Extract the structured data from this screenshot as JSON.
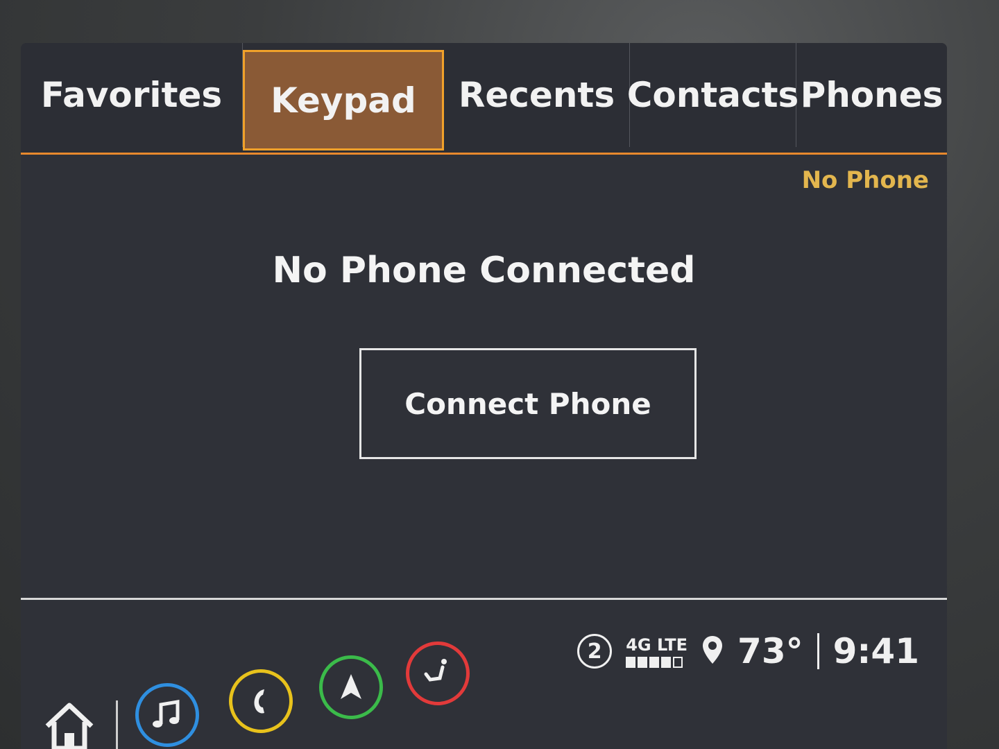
{
  "tabs": [
    {
      "label": "Favorites"
    },
    {
      "label": "Keypad"
    },
    {
      "label": "Recents"
    },
    {
      "label": "Contacts"
    },
    {
      "label": "Phones"
    }
  ],
  "active_tab": "Keypad",
  "status": {
    "phone_state": "No Phone"
  },
  "main": {
    "message": "No Phone Connected",
    "connect_label": "Connect Phone"
  },
  "status_bar": {
    "notification_count": "2",
    "network": "4G LTE",
    "signal_bars_filled": 4,
    "signal_bars_total": 5,
    "temperature": "73°",
    "time": "9:41"
  },
  "dock": [
    {
      "icon": "home-icon"
    },
    {
      "icon": "music-icon",
      "color": "#2f8fe0"
    },
    {
      "icon": "phone-icon",
      "color": "#e8c21c"
    },
    {
      "icon": "navigation-icon",
      "color": "#3bbb4a"
    },
    {
      "icon": "seat-icon",
      "color": "#e23a3a"
    }
  ],
  "colors": {
    "accent": "#e8892d",
    "active_tab_bg": "#8a5a36",
    "status_text": "#e3b64e"
  }
}
